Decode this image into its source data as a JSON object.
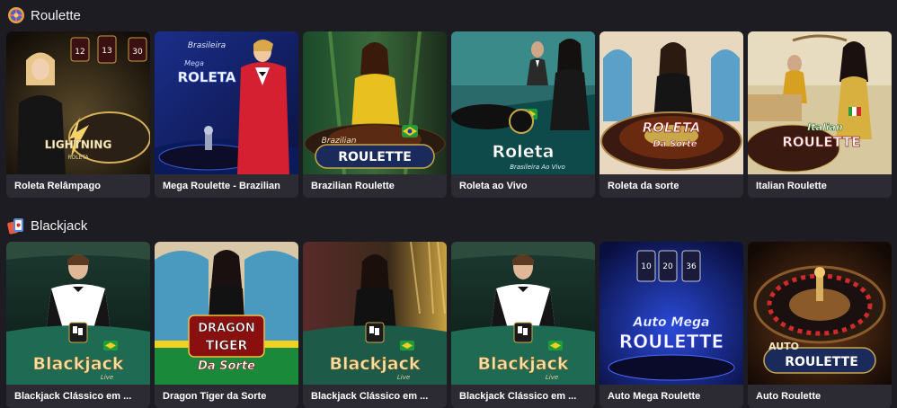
{
  "sections": [
    {
      "title": "Roulette",
      "icon": "roulette-wheel-icon",
      "games": [
        {
          "name": "Roleta Relâmpago",
          "logo_lines": [
            "LIGHTNING",
            "ROLETA"
          ],
          "multipliers": [
            "12",
            "13",
            "30"
          ]
        },
        {
          "name": "Mega Roulette - Brazilian",
          "logo_lines": [
            "Brasileira",
            "Mega",
            "ROLETA"
          ]
        },
        {
          "name": "Brazilian Roulette",
          "logo_lines": [
            "Brazilian",
            "ROULETTE"
          ]
        },
        {
          "name": "Roleta ao Vivo",
          "logo_lines": [
            "Roleta",
            "Brasileira Ao Vivo"
          ]
        },
        {
          "name": "Roleta da sorte",
          "logo_lines": [
            "ROLETA",
            "Da Sorte"
          ]
        },
        {
          "name": "Italian Roulette",
          "logo_lines": [
            "Italian",
            "ROULETTE"
          ]
        }
      ]
    },
    {
      "title": "Blackjack",
      "icon": "playing-cards-icon",
      "games": [
        {
          "name": "Blackjack Clássico em ...",
          "logo_lines": [
            "Blackjack",
            "Live"
          ]
        },
        {
          "name": "Dragon Tiger da Sorte",
          "logo_lines": [
            "DRAGON",
            "TIGER",
            "Da Sorte"
          ]
        },
        {
          "name": "Blackjack Clássico em ...",
          "logo_lines": [
            "Blackjack",
            "Live"
          ]
        },
        {
          "name": "Blackjack Clássico em ...",
          "logo_lines": [
            "Blackjack",
            "Live"
          ]
        },
        {
          "name": "Auto Mega Roulette",
          "logo_lines": [
            "Auto Mega",
            "ROULETTE"
          ],
          "multipliers": [
            "10",
            "20",
            "36"
          ]
        },
        {
          "name": "Auto Roulette",
          "logo_lines": [
            "AUTO",
            "ROULETTE"
          ]
        }
      ]
    }
  ],
  "colors": {
    "background": "#1d1c22",
    "card": "#2c2b33",
    "caption_text": "#ffffff"
  }
}
